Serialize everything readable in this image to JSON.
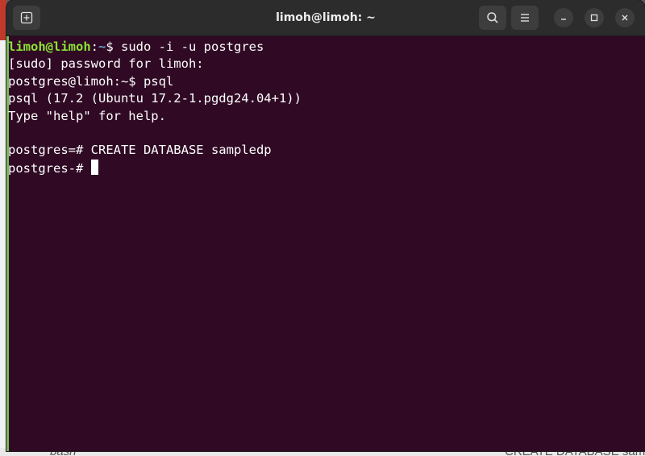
{
  "window": {
    "title": "limoh@limoh: ~"
  },
  "icons": {
    "new_tab": "new-tab-icon",
    "search": "search-icon",
    "menu": "hamburger-menu-icon",
    "minimize": "minimize-icon",
    "maximize": "maximize-icon",
    "close": "close-icon"
  },
  "terminal": {
    "prompt_user": "limoh@limoh",
    "prompt_sep": ":",
    "prompt_path": "~",
    "prompt_end": "$ ",
    "command1": "sudo -i -u postgres",
    "lines": [
      "[sudo] password for limoh:",
      "postgres@limoh:~$ psql",
      "psql (17.2 (Ubuntu 17.2-1.pgdg24.04+1))",
      "Type \"help\" for help.",
      "",
      "postgres=# CREATE DATABASE sampledp",
      "postgres-# "
    ]
  },
  "background": {
    "left_window_text": "bash",
    "right_window_text": "CREATE DATABASE sampled"
  },
  "colors": {
    "terminal_bg": "#300a24",
    "titlebar_bg": "#2c2c2c",
    "prompt_user": "#8ae234",
    "prompt_path": "#729fcf",
    "text": "#ffffff"
  }
}
